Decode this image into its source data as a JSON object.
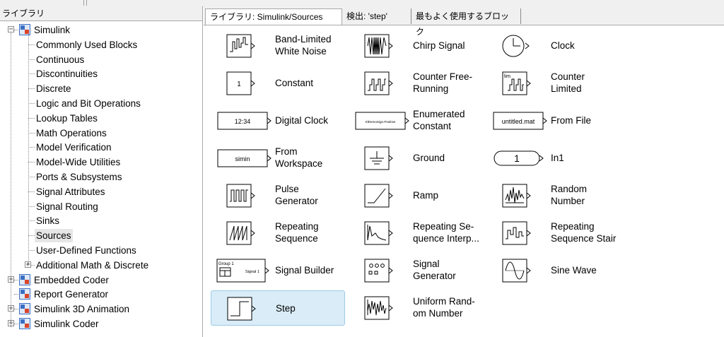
{
  "library_panel": {
    "header": "ライブラリ"
  },
  "tree": [
    {
      "label": "Simulink",
      "level": 0,
      "expander": "-",
      "icon": "library-icon"
    },
    {
      "label": "Commonly Used Blocks",
      "level": 1
    },
    {
      "label": "Continuous",
      "level": 1
    },
    {
      "label": "Discontinuities",
      "level": 1
    },
    {
      "label": "Discrete",
      "level": 1
    },
    {
      "label": "Logic and Bit Operations",
      "level": 1
    },
    {
      "label": "Lookup Tables",
      "level": 1
    },
    {
      "label": "Math Operations",
      "level": 1
    },
    {
      "label": "Model Verification",
      "level": 1
    },
    {
      "label": "Model-Wide Utilities",
      "level": 1
    },
    {
      "label": "Ports & Subsystems",
      "level": 1
    },
    {
      "label": "Signal Attributes",
      "level": 1
    },
    {
      "label": "Signal Routing",
      "level": 1
    },
    {
      "label": "Sinks",
      "level": 1
    },
    {
      "label": "Sources",
      "level": 1,
      "selected": true
    },
    {
      "label": "User-Defined Functions",
      "level": 1
    },
    {
      "label": "Additional Math & Discrete",
      "level": 1,
      "expander": "+"
    },
    {
      "label": "Embedded Coder",
      "level": 0,
      "expander": "+",
      "icon": "library-icon"
    },
    {
      "label": "Report Generator",
      "level": 0,
      "icon": "library-icon"
    },
    {
      "label": "Simulink 3D Animation",
      "level": 0,
      "expander": "+",
      "icon": "library-icon"
    },
    {
      "label": "Simulink Coder",
      "level": 0,
      "expander": "+",
      "icon": "library-icon"
    }
  ],
  "tabs": [
    {
      "label": "ライブラリ: Simulink/Sources",
      "active": true
    },
    {
      "label": "検出: 'step'"
    },
    {
      "label": "最もよく使用するブロック"
    }
  ],
  "blocks": [
    {
      "label": "Band-Limited\nWhite Noise",
      "icon": "band-limited-noise-icon"
    },
    {
      "label": "Chirp Signal",
      "icon": "chirp-signal-icon"
    },
    {
      "label": "Clock",
      "icon": "clock-icon"
    },
    {
      "label": "Constant",
      "icon": "constant-icon",
      "icon_text": "1"
    },
    {
      "label": "Counter Free-\nRunning",
      "icon": "counter-free-running-icon"
    },
    {
      "label": "Counter\nLimited",
      "icon": "counter-limited-icon",
      "icon_text": "lim"
    },
    {
      "label": "Digital Clock",
      "icon": "digital-clock-icon",
      "icon_text": "12:34"
    },
    {
      "label": "Enumerated\nConstant",
      "icon": "enumerated-constant-icon",
      "icon_text": "SlDemoSign.Positive"
    },
    {
      "label": "From File",
      "icon": "from-file-icon",
      "icon_text": "untitled.mat"
    },
    {
      "label": "From\nWorkspace",
      "icon": "from-workspace-icon",
      "icon_text": "simin"
    },
    {
      "label": "Ground",
      "icon": "ground-icon"
    },
    {
      "label": "In1",
      "icon": "inport-icon",
      "icon_text": "1"
    },
    {
      "label": "Pulse\nGenerator",
      "icon": "pulse-generator-icon"
    },
    {
      "label": "Ramp",
      "icon": "ramp-icon"
    },
    {
      "label": "Random\nNumber",
      "icon": "random-number-icon"
    },
    {
      "label": "Repeating\nSequence",
      "icon": "repeating-sequence-icon"
    },
    {
      "label": "Repeating Se-\nquence Interp...",
      "icon": "repeating-sequence-interp-icon"
    },
    {
      "label": "Repeating\nSequence Stair",
      "icon": "repeating-sequence-stair-icon"
    },
    {
      "label": "Signal Builder",
      "icon": "signal-builder-icon",
      "icon_text": "Group 1",
      "icon_text2": "Signal 1"
    },
    {
      "label": "Signal\nGenerator",
      "icon": "signal-generator-icon"
    },
    {
      "label": "Sine Wave",
      "icon": "sine-wave-icon"
    },
    {
      "label": "Step",
      "icon": "step-icon",
      "selected": true
    },
    {
      "label": "Uniform Rand-\nom Number",
      "icon": "uniform-random-number-icon"
    }
  ],
  "colors": {
    "selection": "#d9ecf7",
    "tree_selection": "#e6e6e6",
    "library_icon_blue": "#3a6fc4",
    "library_icon_red": "#d9452b"
  }
}
